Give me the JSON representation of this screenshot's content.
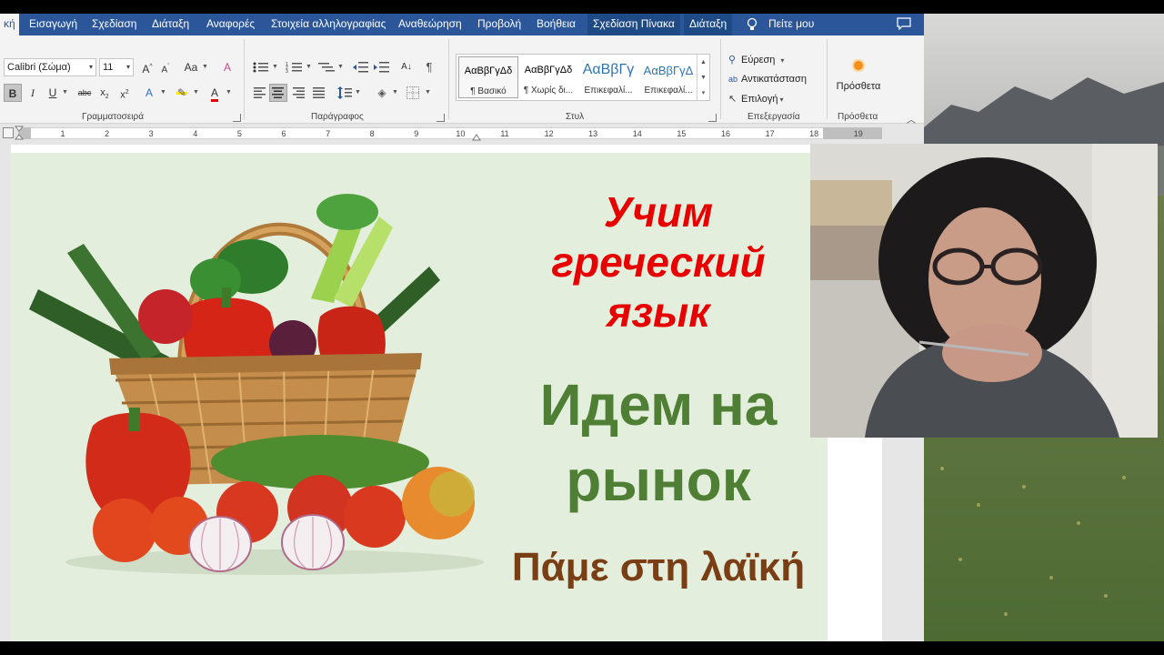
{
  "ribbon_tabs": [
    {
      "label": "κή",
      "active": true
    },
    {
      "label": "Εισαγωγή"
    },
    {
      "label": "Σχεδίαση"
    },
    {
      "label": "Διάταξη"
    },
    {
      "label": "Αναφορές"
    },
    {
      "label": "Στοιχεία αλληλογραφίας"
    },
    {
      "label": "Αναθεώρηση"
    },
    {
      "label": "Προβολή"
    },
    {
      "label": "Βοήθεια"
    },
    {
      "label": "Σχεδίαση Πίνακα",
      "contextual": true
    },
    {
      "label": "Διάταξη",
      "contextual": true
    }
  ],
  "tell_me": "Πείτε μου",
  "font": {
    "name": "Calibri (Σώμα)",
    "size": "11"
  },
  "groups": {
    "font": "Γραμματοσειρά",
    "paragraph": "Παράγραφος",
    "styles": "Στυλ",
    "editing": "Επεξεργασία",
    "addins": "Πρόσθετα"
  },
  "styles": [
    {
      "sample": "ΑαΒβΓγΔδ",
      "name": "¶ Βασικό",
      "selected": true
    },
    {
      "sample": "ΑαΒβΓγΔδ",
      "name": "¶ Χωρίς δι..."
    },
    {
      "sample": "ΑαΒβΓγ",
      "name": "Επικεφαλί...",
      "heading": true
    },
    {
      "sample": "ΑαΒβΓγΔ",
      "name": "Επικεφαλί...",
      "heading": true
    }
  ],
  "editing": {
    "find": "Εύρεση",
    "replace": "Αντικατάσταση",
    "select": "Επιλογή"
  },
  "addins_button": "Πρόσθετα",
  "ruler_numbers": [
    "1",
    "2",
    "3",
    "4",
    "5",
    "6",
    "7",
    "8",
    "9",
    "10",
    "11",
    "12",
    "13",
    "14",
    "15",
    "16",
    "17",
    "18",
    "19"
  ],
  "slide": {
    "title_ru": "Учим греческий язык",
    "subtitle_ru": "Идем на рынок",
    "subtitle_gr": "Πάμε στη λαϊκή"
  },
  "colors": {
    "word_blue": "#2b579a",
    "title_red": "#e80000",
    "subtitle_green": "#4f7f35",
    "subtitle_brown": "#7a3e14",
    "slide_bg": "#e3efdc"
  }
}
